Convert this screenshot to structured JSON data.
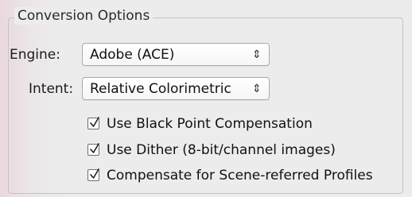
{
  "group": {
    "title": "Conversion Options"
  },
  "engine": {
    "label": "Engine:",
    "value": "Adobe (ACE)",
    "arrows": "⇕"
  },
  "intent": {
    "label": "Intent:",
    "value": "Relative Colorimetric",
    "arrows": "⇕"
  },
  "options": [
    {
      "label": "Use Black Point Compensation",
      "checked": true
    },
    {
      "label": "Use Dither (8-bit/channel images)",
      "checked": true
    },
    {
      "label": "Compensate for Scene-referred Profiles",
      "checked": true
    }
  ],
  "icons": {
    "checkmark": "checkmark-icon",
    "select_arrows": "select-arrows-icon"
  }
}
